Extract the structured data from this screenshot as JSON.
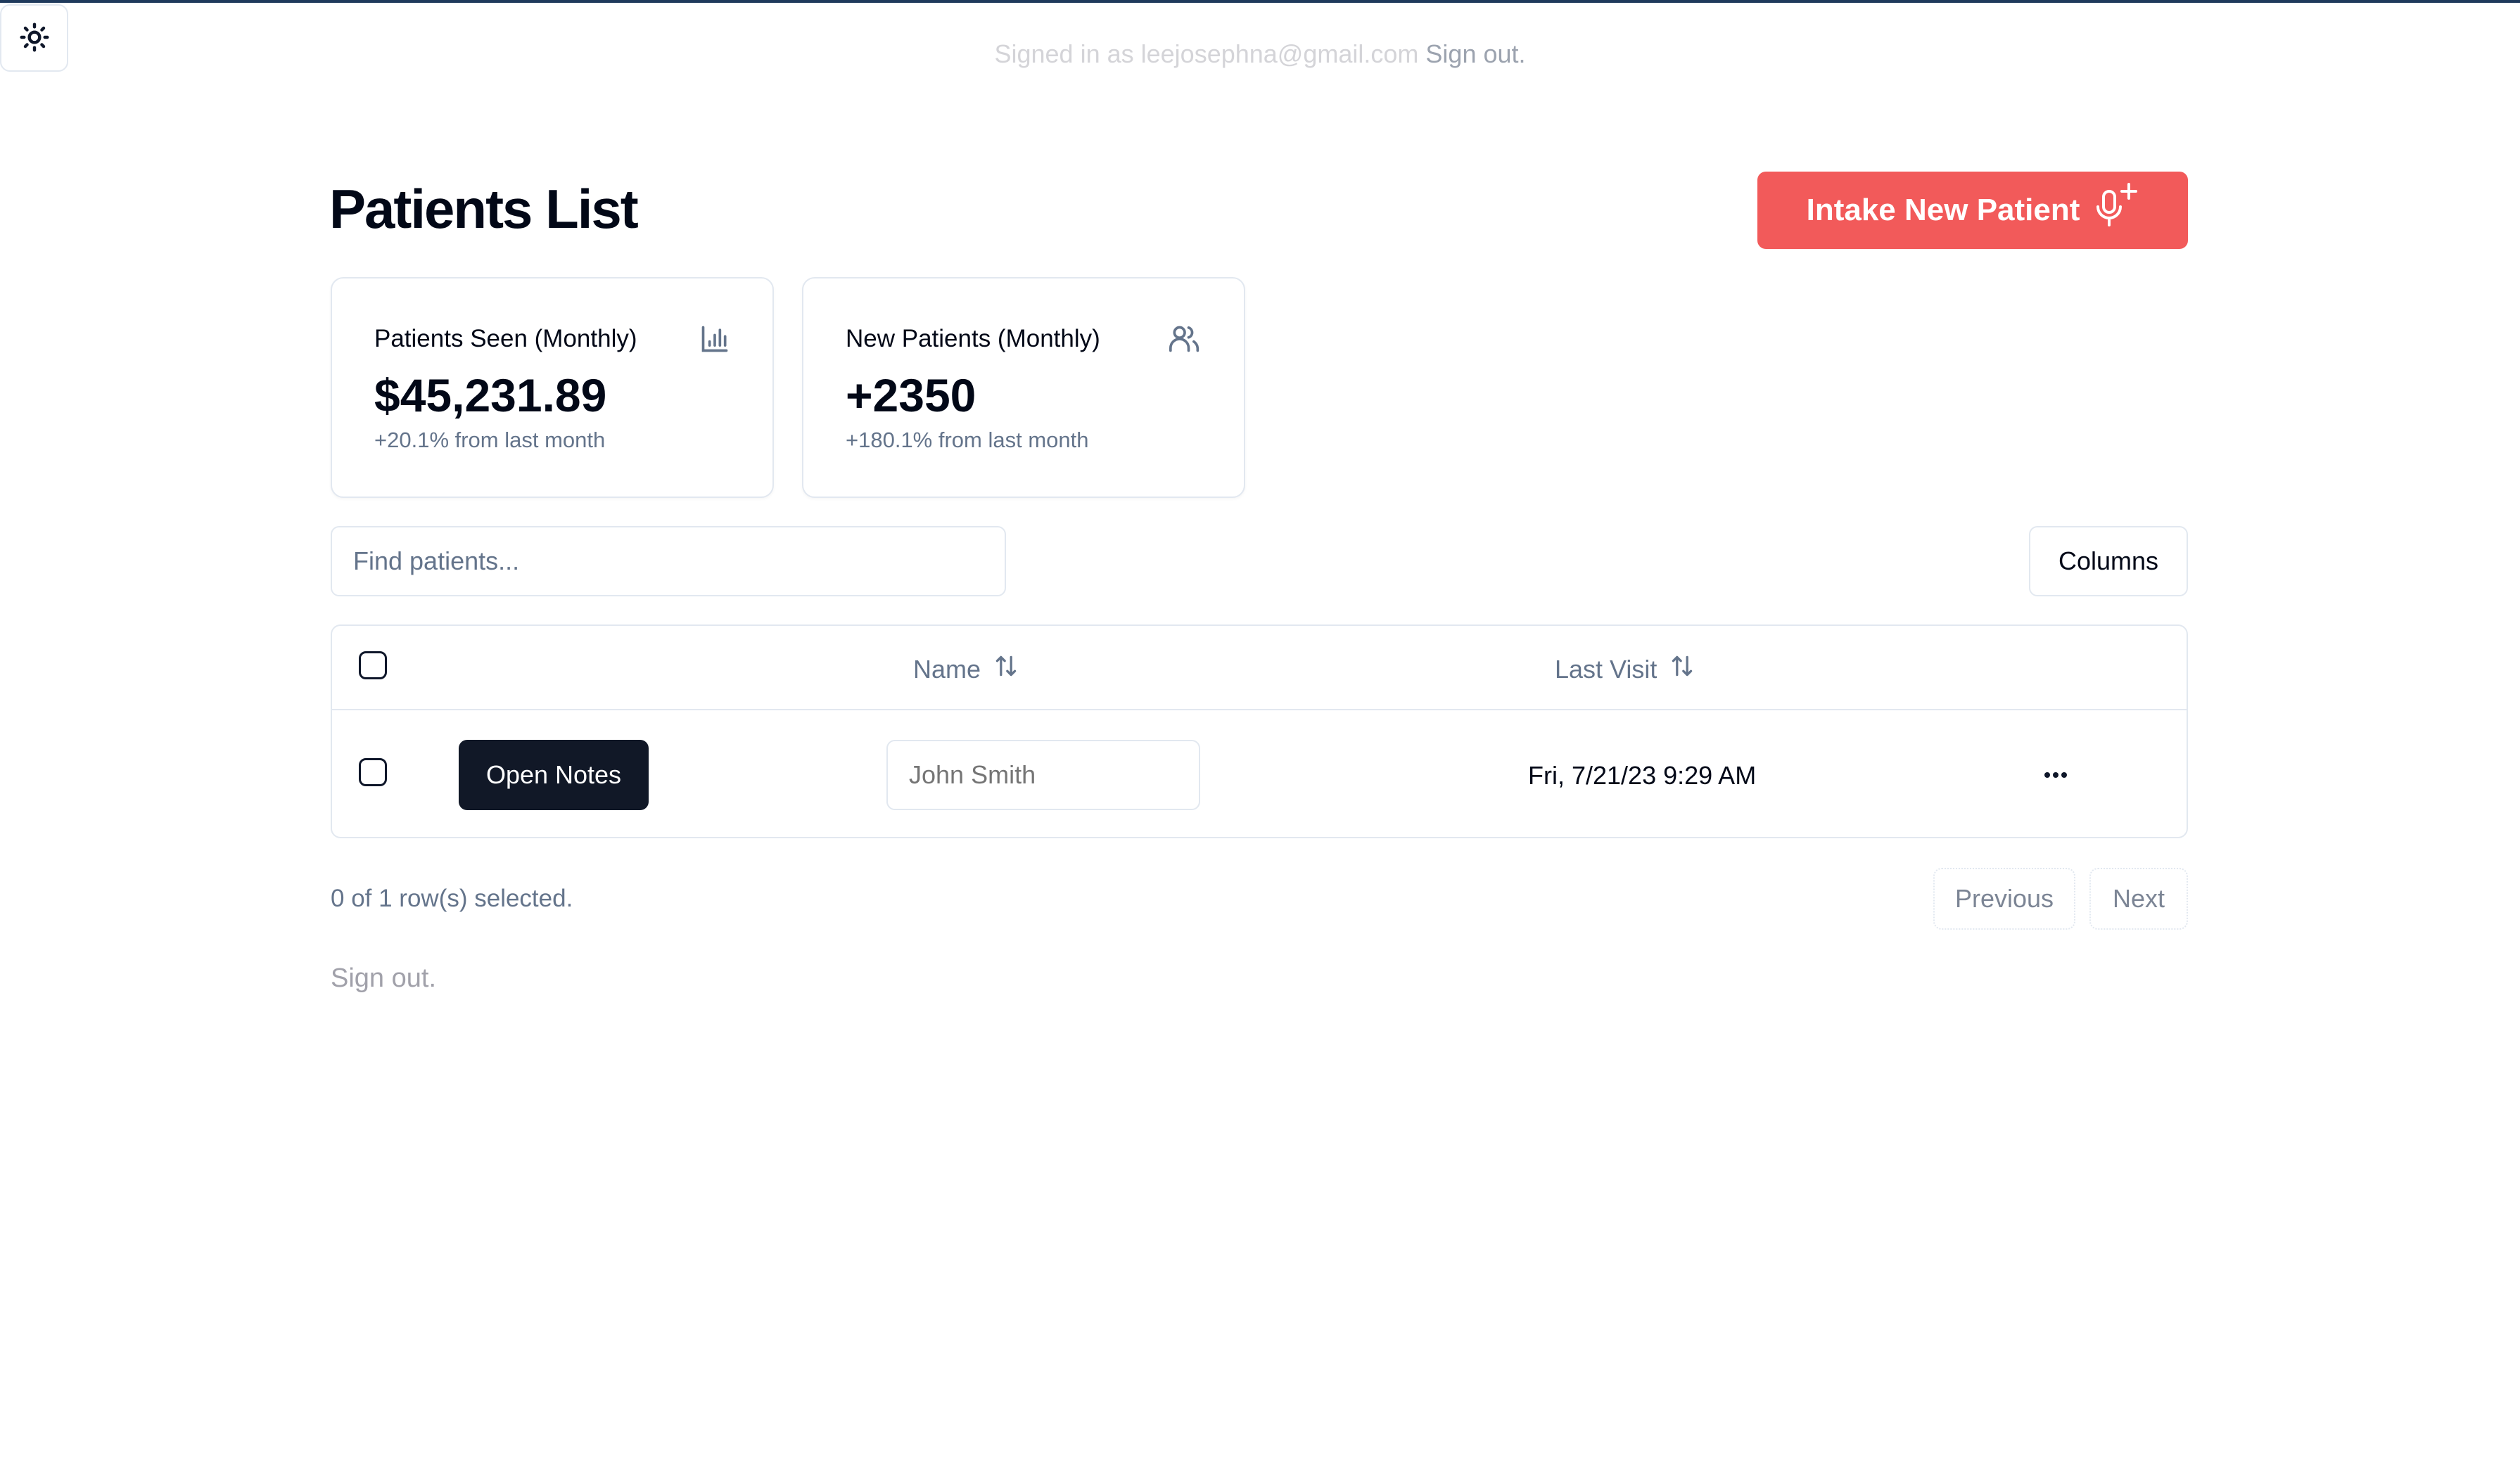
{
  "header": {
    "theme_toggle_icon": "sun-icon",
    "signed_in_prefix": "Signed in as leejosephna@gmail.com",
    "sign_out_label": "Sign out."
  },
  "page": {
    "title": "Patients List",
    "intake_button_label": "Intake New Patient",
    "intake_button_icon": "microphone-plus-icon",
    "accent_color": "#f25a5a"
  },
  "stats": [
    {
      "title": "Patients Seen (Monthly)",
      "icon": "bar-chart-icon",
      "value": "$45,231.89",
      "change": "+20.1% from last month"
    },
    {
      "title": "New Patients (Monthly)",
      "icon": "users-icon",
      "value": "+2350",
      "change": "+180.1% from last month"
    }
  ],
  "toolbar": {
    "search_placeholder": "Find patients...",
    "search_value": "",
    "columns_label": "Columns"
  },
  "table": {
    "columns": [
      {
        "label": "Name",
        "sort_icon": "sort-arrows-icon"
      },
      {
        "label": "Last Visit",
        "sort_icon": "sort-arrows-icon"
      }
    ],
    "rows": [
      {
        "selected": false,
        "action_label": "Open Notes",
        "name_placeholder": "John Smith",
        "last_visit": "Fri, 7/21/23 9:29 AM",
        "menu_icon": "more-horizontal-icon"
      }
    ]
  },
  "footer": {
    "selection_status": "0 of 1 row(s) selected.",
    "previous_label": "Previous",
    "next_label": "Next",
    "sign_out_label": "Sign out."
  }
}
